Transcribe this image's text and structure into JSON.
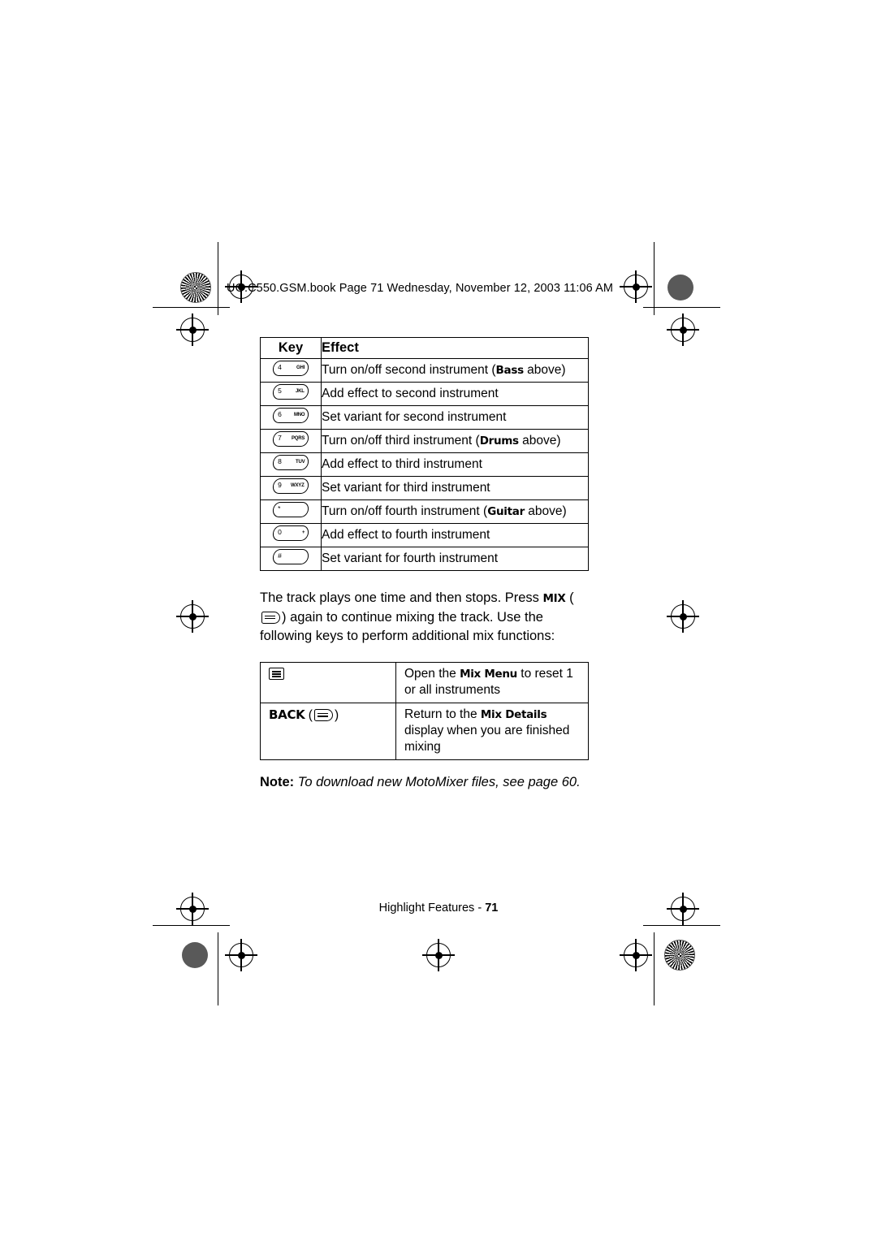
{
  "header": {
    "text": "UG.C550.GSM.book  Page 71  Wednesday, November 12, 2003  11:06 AM"
  },
  "key_table": {
    "columns": [
      "Key",
      "Effect"
    ],
    "rows": [
      {
        "key_main": "4",
        "key_sub": "GHI",
        "effect_pre": "Turn on/off second instrument (",
        "effect_disp": "Bass",
        "effect_post": " above)"
      },
      {
        "key_main": "5",
        "key_sub": "JKL",
        "effect_pre": "Add effect to second instrument",
        "effect_disp": "",
        "effect_post": ""
      },
      {
        "key_main": "6",
        "key_sub": "MNO",
        "effect_pre": "Set variant for second instrument",
        "effect_disp": "",
        "effect_post": ""
      },
      {
        "key_main": "7",
        "key_sub": "PQRS",
        "effect_pre": "Turn on/off third instrument (",
        "effect_disp": "Drums",
        "effect_post": " above)"
      },
      {
        "key_main": "8",
        "key_sub": "TUV",
        "effect_pre": "Add effect to third instrument",
        "effect_disp": "",
        "effect_post": ""
      },
      {
        "key_main": "9",
        "key_sub": "WXYZ",
        "effect_pre": "Set variant for third instrument",
        "effect_disp": "",
        "effect_post": ""
      },
      {
        "key_main": "*",
        "key_sub": "",
        "effect_pre": "Turn on/off fourth instrument (",
        "effect_disp": "Guitar",
        "effect_post": " above)"
      },
      {
        "key_main": "0",
        "key_sub": "+",
        "effect_pre": "Add effect to fourth instrument",
        "effect_disp": "",
        "effect_post": ""
      },
      {
        "key_main": "#",
        "key_sub": "",
        "effect_pre": "Set variant for fourth instrument",
        "effect_disp": "",
        "effect_post": ""
      }
    ]
  },
  "paragraph": {
    "part1": "The track plays one time and then stops. Press ",
    "mix_label": "MIX",
    "part2": " (",
    "part3": ") again to continue mixing the track. Use the following keys to perform additional mix functions:"
  },
  "soft_table": {
    "rows": [
      {
        "key_label": "",
        "key_icon": "menu-icon",
        "effect_pre": "Open the ",
        "effect_disp": "Mix Menu",
        "effect_post": " to reset 1 or all instruments"
      },
      {
        "key_label": "BACK",
        "key_icon": "softkey-icon",
        "effect_pre": "Return to the ",
        "effect_disp": "Mix Details",
        "effect_post": " display when you are finished mixing"
      }
    ]
  },
  "note": {
    "label": "Note:",
    "text": " To download new MotoMixer files, see page 60."
  },
  "footer": {
    "label": "Highlight Features - ",
    "page": "71"
  }
}
